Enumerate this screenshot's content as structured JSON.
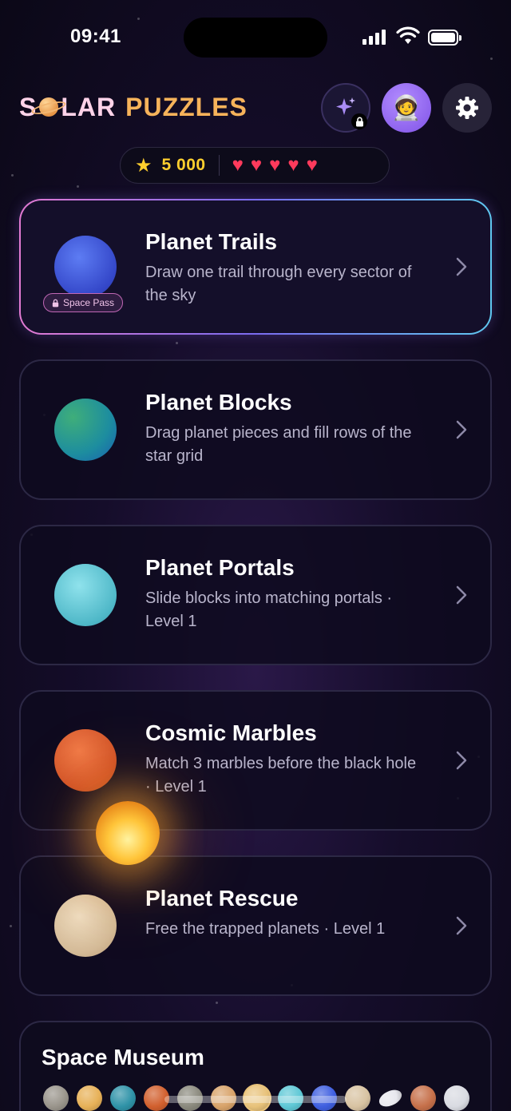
{
  "status_bar": {
    "time": "09:41"
  },
  "header": {
    "logo_part1": "S",
    "logo_part2": "LAR",
    "logo_part3": "PUZZLES",
    "avatar_emoji": "🧑‍🚀"
  },
  "stats": {
    "coins": "5 000",
    "hearts": 5
  },
  "games": [
    {
      "title": "Planet Trails",
      "description": "Draw one trail through every sector of the sky",
      "badge": "Space Pass",
      "planet_color": "#3f5fe0"
    },
    {
      "title": "Planet Blocks",
      "description": "Drag planet pieces and fill rows of the star grid",
      "planet_color": "#1f8fa0"
    },
    {
      "title": "Planet Portals",
      "description": "Slide blocks into matching portals · Level 1",
      "planet_color": "#5cc4d4"
    },
    {
      "title": "Cosmic Marbles",
      "description": "Match 3 marbles before the black hole · Level 1",
      "planet_color": "#d45a2c"
    },
    {
      "title": "Planet Rescue",
      "description": "Free the trapped planets · Level 1",
      "planet_color": "#d8c3a2"
    }
  ],
  "museum": {
    "title": "Space Museum",
    "planet_colors": [
      "#9a958c",
      "#e7b158",
      "#2f93a8",
      "#d2602e",
      "#8b8a7e",
      "#d8a36a",
      "#e8c27a",
      "#5ec8d6",
      "#3f5fe0",
      "#d8c3a2",
      "#e8e8ee",
      "#c6704a",
      "#d9dbe2"
    ]
  }
}
